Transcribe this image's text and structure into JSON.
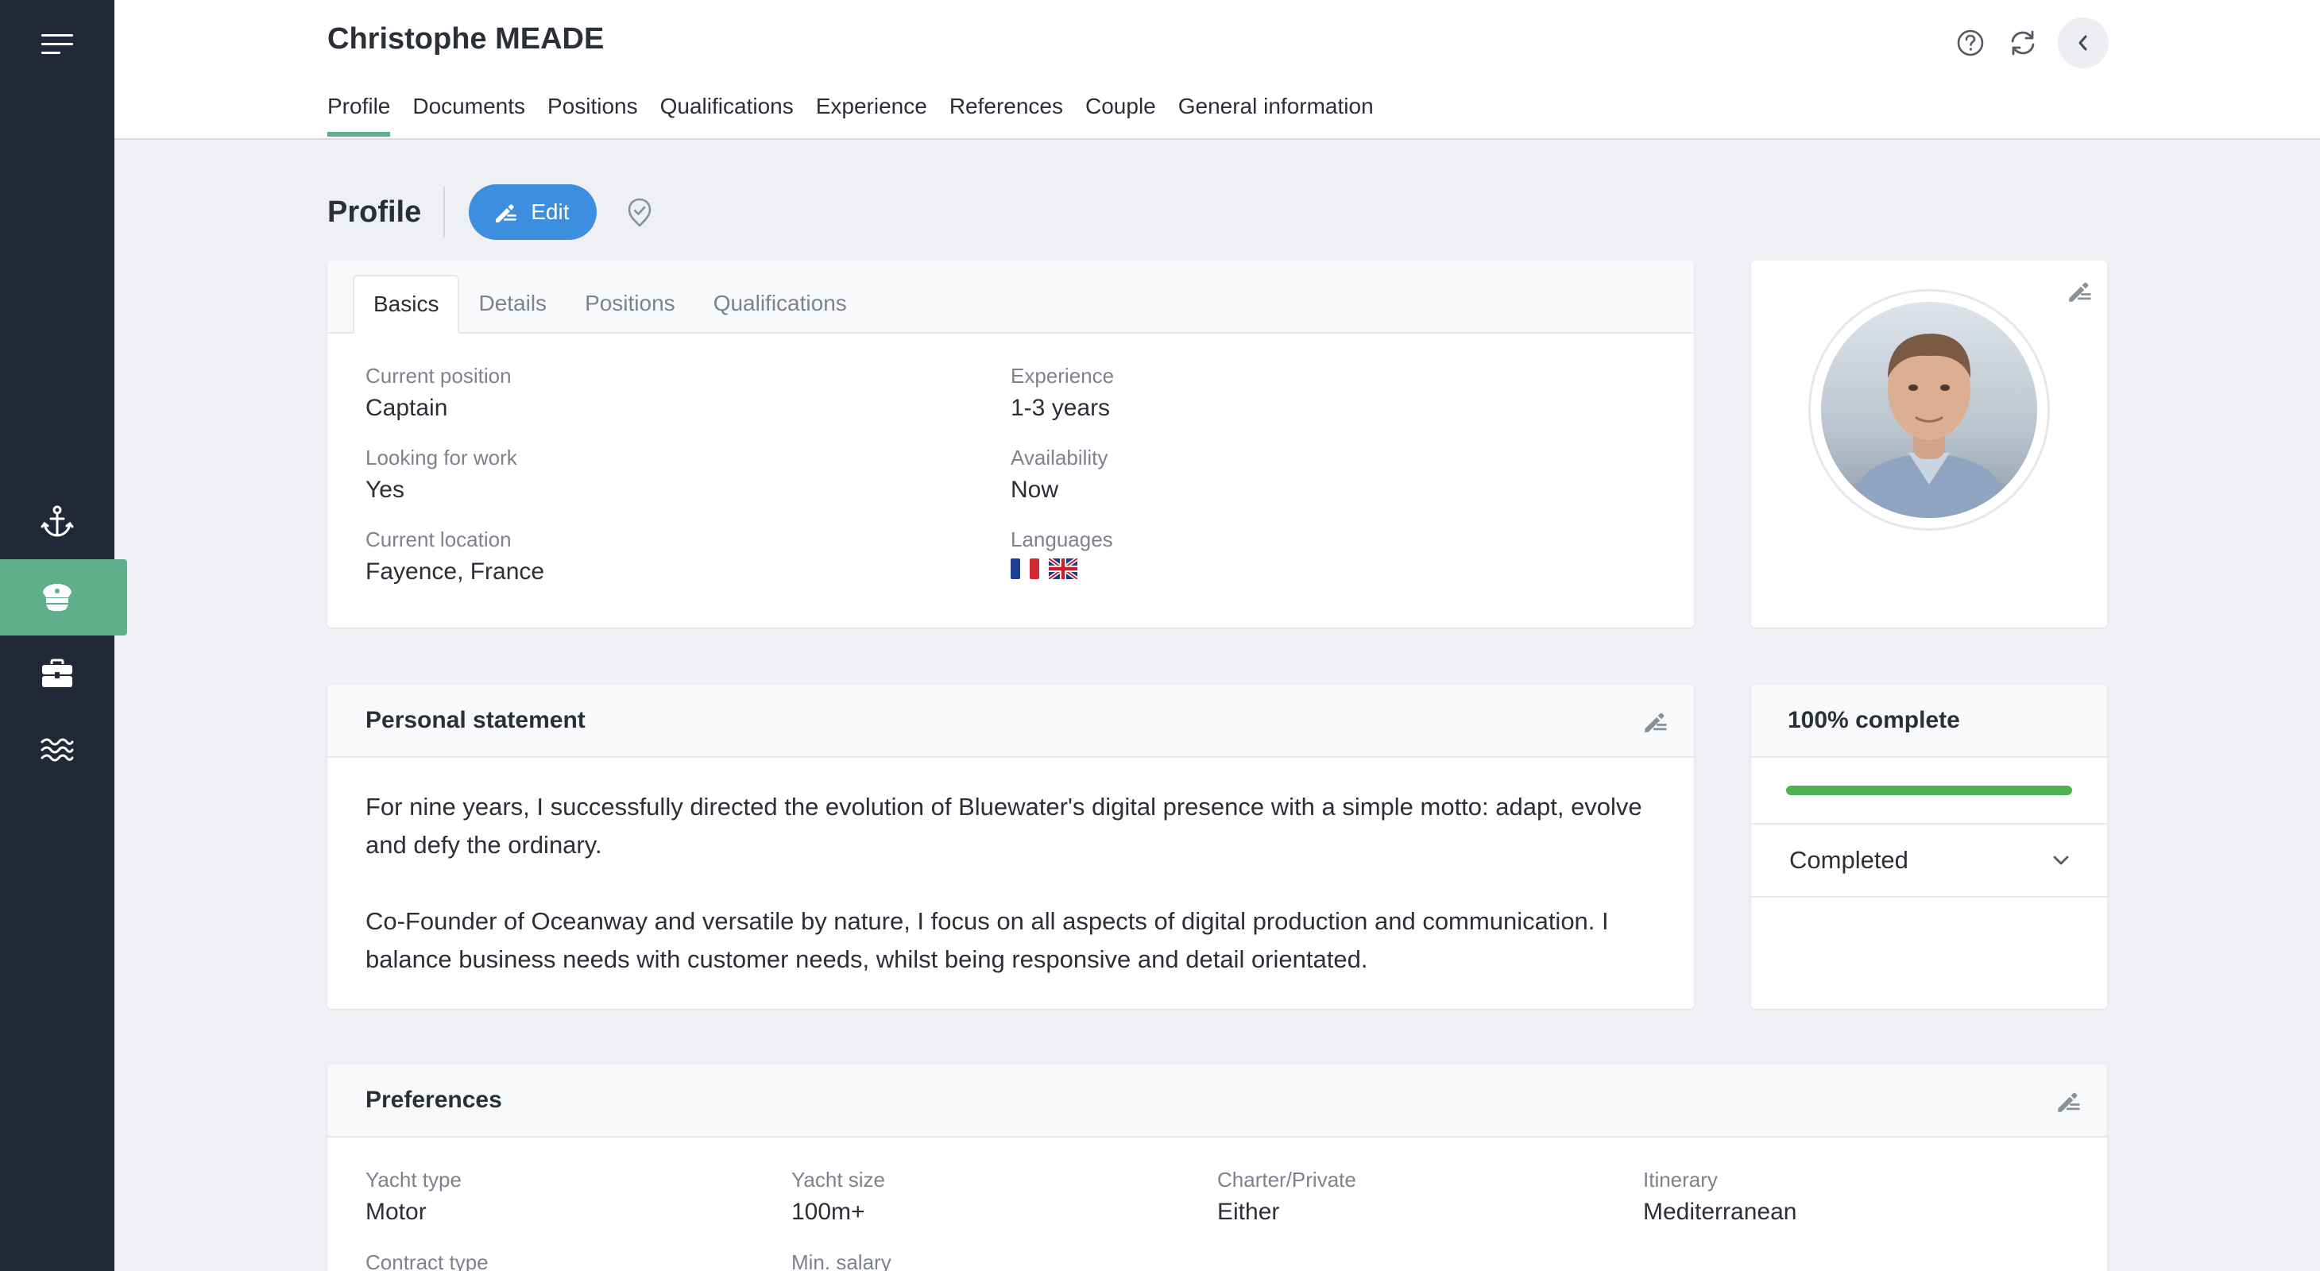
{
  "header": {
    "title": "Christophe MEADE",
    "tabs": [
      {
        "label": "Profile",
        "active": true
      },
      {
        "label": "Documents"
      },
      {
        "label": "Positions"
      },
      {
        "label": "Qualifications"
      },
      {
        "label": "Experience"
      },
      {
        "label": "References"
      },
      {
        "label": "Couple"
      },
      {
        "label": "General information"
      }
    ],
    "icons": [
      "help-icon",
      "refresh-icon",
      "chevron-left-icon"
    ]
  },
  "sidebar": {
    "items": [
      {
        "icon": "menu-icon"
      },
      {
        "icon": "anchor-icon"
      },
      {
        "icon": "captain-hat-icon",
        "active": true
      },
      {
        "icon": "briefcase-icon"
      },
      {
        "icon": "waves-icon"
      }
    ]
  },
  "section": {
    "title": "Profile",
    "edit_label": "Edit"
  },
  "profile": {
    "tabs": [
      "Basics",
      "Details",
      "Positions",
      "Qualifications"
    ],
    "fields": {
      "current_position": {
        "label": "Current position",
        "value": "Captain"
      },
      "looking_for_work": {
        "label": "Looking for work",
        "value": "Yes"
      },
      "current_location": {
        "label": "Current location",
        "value": "Fayence, France"
      },
      "experience": {
        "label": "Experience",
        "value": "1-3 years"
      },
      "availability": {
        "label": "Availability",
        "value": "Now"
      },
      "languages": {
        "label": "Languages",
        "flags": [
          "flag-france-icon",
          "flag-uk-icon"
        ]
      }
    }
  },
  "statement": {
    "title": "Personal statement",
    "paragraphs": [
      "For nine years, I successfully directed the evolution of Bluewater's digital presence with a simple motto: adapt, evolve and defy the ordinary.",
      "Co-Founder of Oceanway and versatile by nature, I focus on all aspects of digital production and communication. I balance business needs with customer needs, whilst being responsive and detail orientated."
    ]
  },
  "completion": {
    "title": "100% complete",
    "percent": 100,
    "status": "Completed"
  },
  "preferences": {
    "title": "Preferences",
    "fields": {
      "yacht_type": {
        "label": "Yacht type",
        "value": "Motor"
      },
      "yacht_size": {
        "label": "Yacht size",
        "value": "100m+"
      },
      "charter_private": {
        "label": "Charter/Private",
        "value": "Either"
      },
      "itinerary": {
        "label": "Itinerary",
        "value": "Mediterranean"
      },
      "contract_type": {
        "label": "Contract type",
        "value": ""
      },
      "min_salary": {
        "label": "Min. salary",
        "value": ""
      }
    }
  },
  "colors": {
    "sidebar": "#232838",
    "accent_green": "#5fae8c",
    "edit_blue": "#3d8ede",
    "progress_green": "#4caf50"
  }
}
